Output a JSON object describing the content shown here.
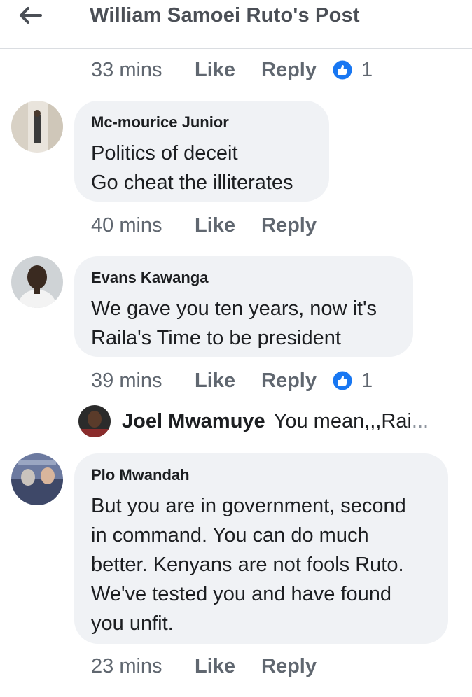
{
  "header": {
    "back_icon": "back-arrow-icon",
    "title": "William Samoei Ruto's Post"
  },
  "top_meta": {
    "time": "33 mins",
    "like": "Like",
    "reply": "Reply",
    "reaction_icon": "like-reaction-icon",
    "reaction_count": "1"
  },
  "comments": [
    {
      "author": "Mc-mourice Junior",
      "text": "Politics of deceit\nGo cheat the illiterates",
      "time": "40 mins",
      "like": "Like",
      "reply": "Reply"
    },
    {
      "author": "Evans Kawanga",
      "text": "We gave you ten years, now it's\nRaila's Time to be president",
      "time": "39 mins",
      "like": "Like",
      "reply": "Reply",
      "reaction_icon": "like-reaction-icon",
      "reaction_count": "1",
      "reply_preview": {
        "author": "Joel Mwamuye",
        "text": "You mean,,,Rai",
        "ellipsis": "..."
      }
    },
    {
      "author": "Plo Mwandah",
      "text": "But you are in government, second\nin command. You can do much\nbetter. Kenyans are not fools Ruto.\nWe've tested you and have found\nyou unfit.",
      "time": "23 mins",
      "like": "Like",
      "reply": "Reply"
    }
  ],
  "colors": {
    "like_blue": "#1877f2",
    "bubble": "#f0f2f5",
    "meta_gray": "#606770"
  }
}
